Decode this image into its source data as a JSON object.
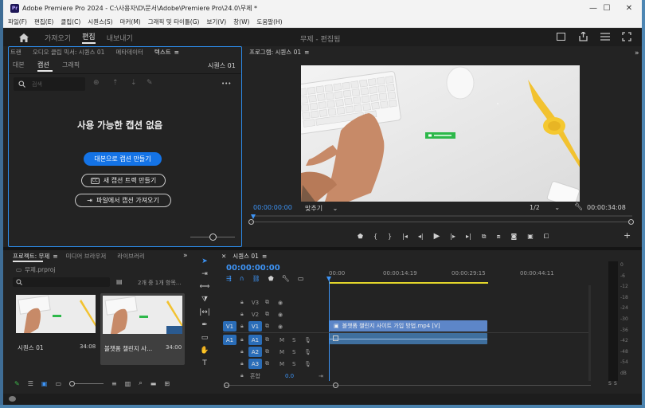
{
  "titlebar": {
    "app_icon": "Pr",
    "title": "Adobe Premiere Pro 2024 - C:\\사용자\\D\\문서\\Adobe\\Premiere Pro\\24.0\\무제 *",
    "minimize": "—",
    "maximize": "☐",
    "close": "✕"
  },
  "menu": {
    "file": "파일(F)",
    "edit": "편집(E)",
    "clip": "클립(C)",
    "sequence": "시퀀스(S)",
    "markers": "마커(M)",
    "graphics": "그래픽 및 타이틀(G)",
    "view": "보기(V)",
    "window": "창(W)",
    "help": "도움말(H)"
  },
  "workspace": {
    "home_icon": "home-icon",
    "import": "가져오기",
    "edit": "편집",
    "export": "내보내기",
    "project_title": "무제 - 편집됨"
  },
  "text_panel": {
    "tabs": [
      "트랜",
      "오디오 클립 믹서: 시퀀스 01",
      "메타데이터",
      "텍스트"
    ],
    "tab_menu": "≡",
    "subtabs": [
      "대본",
      "캡션",
      "그래픽"
    ],
    "sequence": "시퀀스 01",
    "search_placeholder": "검색",
    "empty_title": "사용 가능한 캡션 없음",
    "btn_transcript": "대본으로 캡션 만들기",
    "btn_new_track": "새 캡션 트랙 만들기",
    "btn_import_file": "파일에서 캡션 가져오기",
    "more": "•••",
    "cc_badge": "CC"
  },
  "program": {
    "title": "프로그램: 시퀀스 01",
    "menu": "≡",
    "timecode_in": "00:00:00:00",
    "fit": "맞추기",
    "resolution": "1/2",
    "duration": "00:00:34:08",
    "overflow": "»",
    "add": "+"
  },
  "project": {
    "tabs": [
      "프로젝트: 무제",
      "미디어 브라우저",
      "라이브러리"
    ],
    "menu": "≡",
    "overflow": "»",
    "file": "무제.prproj",
    "count": "2개 중 1개 항목...",
    "items": [
      {
        "name": "시퀀스 01",
        "duration": "34:08"
      },
      {
        "name": "볼챗폼 챌린지 사...",
        "duration": "34:00"
      }
    ]
  },
  "timeline": {
    "close": "✕",
    "title": "시퀀스 01",
    "menu": "≡",
    "timecode": "00:00:00:00",
    "ruler": [
      "00:00",
      "00:00:14:19",
      "00:00:29:15",
      "00:00:44:11"
    ],
    "tracks_video": [
      "V3",
      "V2",
      "V1"
    ],
    "tracks_audio": [
      "A1",
      "A2",
      "A3"
    ],
    "src_v1": "V1",
    "src_a1": "A1",
    "mix": "혼합",
    "mix_value": "0.0",
    "clip_video": "볼챗폼 챌린지 사이트 가입 방법.mp4 [V]"
  },
  "meter": {
    "scale": [
      "0",
      "-6",
      "-12",
      "-18",
      "-24",
      "-30",
      "-36",
      "-42",
      "-48",
      "-54",
      "dB"
    ],
    "solo": "S"
  },
  "colors": {
    "accent": "#2d8ceb",
    "clip_video": "#5d86c8",
    "clip_audio": "#3f6f9e",
    "playhead": "#3d94f6",
    "work_area": "#e3d62b"
  }
}
